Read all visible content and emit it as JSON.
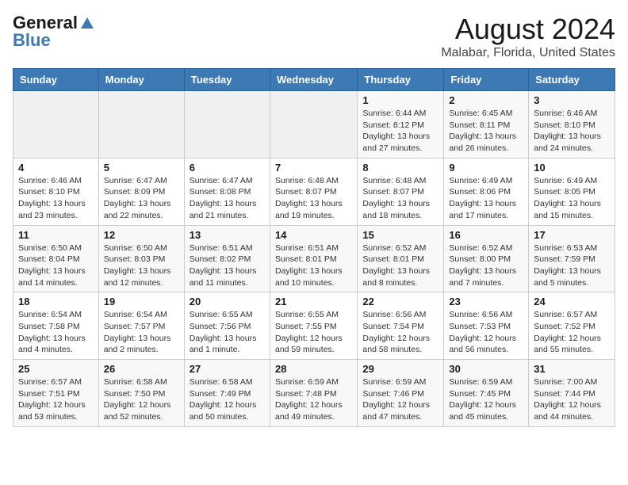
{
  "header": {
    "logo_general": "General",
    "logo_blue": "Blue",
    "main_title": "August 2024",
    "subtitle": "Malabar, Florida, United States"
  },
  "weekdays": [
    "Sunday",
    "Monday",
    "Tuesday",
    "Wednesday",
    "Thursday",
    "Friday",
    "Saturday"
  ],
  "weeks": [
    [
      {
        "day": "",
        "info": ""
      },
      {
        "day": "",
        "info": ""
      },
      {
        "day": "",
        "info": ""
      },
      {
        "day": "",
        "info": ""
      },
      {
        "day": "1",
        "info": "Sunrise: 6:44 AM\nSunset: 8:12 PM\nDaylight: 13 hours and 27 minutes."
      },
      {
        "day": "2",
        "info": "Sunrise: 6:45 AM\nSunset: 8:11 PM\nDaylight: 13 hours and 26 minutes."
      },
      {
        "day": "3",
        "info": "Sunrise: 6:46 AM\nSunset: 8:10 PM\nDaylight: 13 hours and 24 minutes."
      }
    ],
    [
      {
        "day": "4",
        "info": "Sunrise: 6:46 AM\nSunset: 8:10 PM\nDaylight: 13 hours and 23 minutes."
      },
      {
        "day": "5",
        "info": "Sunrise: 6:47 AM\nSunset: 8:09 PM\nDaylight: 13 hours and 22 minutes."
      },
      {
        "day": "6",
        "info": "Sunrise: 6:47 AM\nSunset: 8:08 PM\nDaylight: 13 hours and 21 minutes."
      },
      {
        "day": "7",
        "info": "Sunrise: 6:48 AM\nSunset: 8:07 PM\nDaylight: 13 hours and 19 minutes."
      },
      {
        "day": "8",
        "info": "Sunrise: 6:48 AM\nSunset: 8:07 PM\nDaylight: 13 hours and 18 minutes."
      },
      {
        "day": "9",
        "info": "Sunrise: 6:49 AM\nSunset: 8:06 PM\nDaylight: 13 hours and 17 minutes."
      },
      {
        "day": "10",
        "info": "Sunrise: 6:49 AM\nSunset: 8:05 PM\nDaylight: 13 hours and 15 minutes."
      }
    ],
    [
      {
        "day": "11",
        "info": "Sunrise: 6:50 AM\nSunset: 8:04 PM\nDaylight: 13 hours and 14 minutes."
      },
      {
        "day": "12",
        "info": "Sunrise: 6:50 AM\nSunset: 8:03 PM\nDaylight: 13 hours and 12 minutes."
      },
      {
        "day": "13",
        "info": "Sunrise: 6:51 AM\nSunset: 8:02 PM\nDaylight: 13 hours and 11 minutes."
      },
      {
        "day": "14",
        "info": "Sunrise: 6:51 AM\nSunset: 8:01 PM\nDaylight: 13 hours and 10 minutes."
      },
      {
        "day": "15",
        "info": "Sunrise: 6:52 AM\nSunset: 8:01 PM\nDaylight: 13 hours and 8 minutes."
      },
      {
        "day": "16",
        "info": "Sunrise: 6:52 AM\nSunset: 8:00 PM\nDaylight: 13 hours and 7 minutes."
      },
      {
        "day": "17",
        "info": "Sunrise: 6:53 AM\nSunset: 7:59 PM\nDaylight: 13 hours and 5 minutes."
      }
    ],
    [
      {
        "day": "18",
        "info": "Sunrise: 6:54 AM\nSunset: 7:58 PM\nDaylight: 13 hours and 4 minutes."
      },
      {
        "day": "19",
        "info": "Sunrise: 6:54 AM\nSunset: 7:57 PM\nDaylight: 13 hours and 2 minutes."
      },
      {
        "day": "20",
        "info": "Sunrise: 6:55 AM\nSunset: 7:56 PM\nDaylight: 13 hours and 1 minute."
      },
      {
        "day": "21",
        "info": "Sunrise: 6:55 AM\nSunset: 7:55 PM\nDaylight: 12 hours and 59 minutes."
      },
      {
        "day": "22",
        "info": "Sunrise: 6:56 AM\nSunset: 7:54 PM\nDaylight: 12 hours and 58 minutes."
      },
      {
        "day": "23",
        "info": "Sunrise: 6:56 AM\nSunset: 7:53 PM\nDaylight: 12 hours and 56 minutes."
      },
      {
        "day": "24",
        "info": "Sunrise: 6:57 AM\nSunset: 7:52 PM\nDaylight: 12 hours and 55 minutes."
      }
    ],
    [
      {
        "day": "25",
        "info": "Sunrise: 6:57 AM\nSunset: 7:51 PM\nDaylight: 12 hours and 53 minutes."
      },
      {
        "day": "26",
        "info": "Sunrise: 6:58 AM\nSunset: 7:50 PM\nDaylight: 12 hours and 52 minutes."
      },
      {
        "day": "27",
        "info": "Sunrise: 6:58 AM\nSunset: 7:49 PM\nDaylight: 12 hours and 50 minutes."
      },
      {
        "day": "28",
        "info": "Sunrise: 6:59 AM\nSunset: 7:48 PM\nDaylight: 12 hours and 49 minutes."
      },
      {
        "day": "29",
        "info": "Sunrise: 6:59 AM\nSunset: 7:46 PM\nDaylight: 12 hours and 47 minutes."
      },
      {
        "day": "30",
        "info": "Sunrise: 6:59 AM\nSunset: 7:45 PM\nDaylight: 12 hours and 45 minutes."
      },
      {
        "day": "31",
        "info": "Sunrise: 7:00 AM\nSunset: 7:44 PM\nDaylight: 12 hours and 44 minutes."
      }
    ]
  ]
}
